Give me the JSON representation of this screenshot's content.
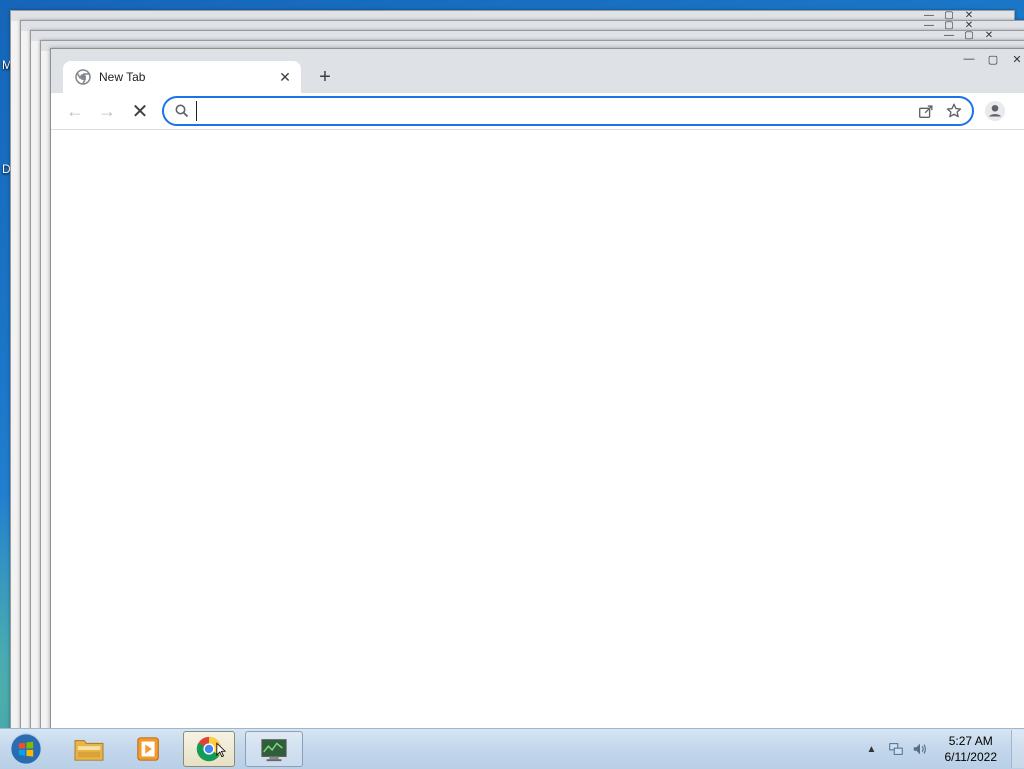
{
  "desktop": {
    "icon_letters": [
      "M",
      "D"
    ]
  },
  "background_windows": [
    {
      "controls": [
        "—",
        "▢",
        "✕"
      ]
    },
    {
      "controls": [
        "—",
        "▢",
        "✕"
      ]
    },
    {
      "controls": [
        "—",
        "▢",
        "✕"
      ]
    }
  ],
  "browser": {
    "tab": {
      "title": "New Tab",
      "close": "✕"
    },
    "new_tab": "+",
    "window_controls": {
      "minimize": "—",
      "restore": "▢",
      "close": "✕"
    },
    "toolbar": {
      "back": "←",
      "forward": "→",
      "stop": "✕",
      "omnibox_value": ""
    }
  },
  "taskbar": {
    "apps": [
      {
        "name": "file-explorer"
      },
      {
        "name": "media-player"
      },
      {
        "name": "google-chrome",
        "active": true
      },
      {
        "name": "network-tool"
      }
    ],
    "tray": {
      "overflow": "▲"
    },
    "clock": {
      "time": "5:27 AM",
      "date": "6/11/2022"
    }
  },
  "colors": {
    "accent": "#1a73e8",
    "tabstrip": "#dee1e6",
    "desktop": "#1b77c9"
  }
}
